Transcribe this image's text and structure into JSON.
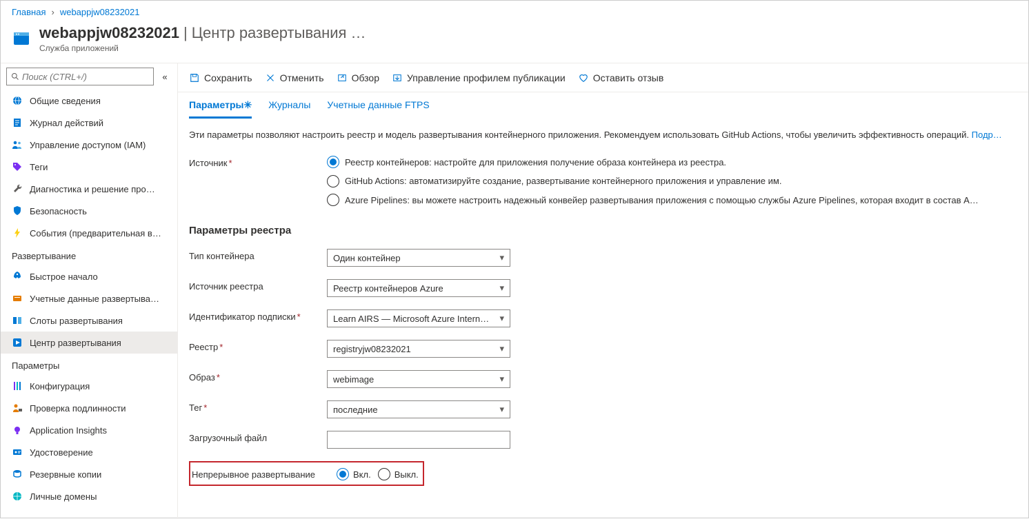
{
  "breadcrumb": {
    "home": "Главная",
    "resource": "webappjw08232021"
  },
  "header": {
    "title_main": "webappjw08232021",
    "title_sub": "Центр развертывания",
    "more": "…",
    "subtitle": "Служба приложений"
  },
  "search": {
    "placeholder": "Поиск (CTRL+/)",
    "collapse_glyph": "«"
  },
  "sidebar": {
    "section_general": [
      {
        "label": "Общие сведения"
      },
      {
        "label": "Журнал действий"
      },
      {
        "label": "Управление доступом (IAM)"
      },
      {
        "label": "Теги"
      },
      {
        "label": "Диагностика и решение про…"
      },
      {
        "label": "Безопасность"
      },
      {
        "label": "События (предварительная в…"
      }
    ],
    "section_deploy_title": "Развертывание",
    "section_deploy": [
      {
        "label": "Быстрое начало"
      },
      {
        "label": "Учетные данные развертыва…"
      },
      {
        "label": "Слоты развертывания"
      },
      {
        "label": "Центр развертывания",
        "active": true
      }
    ],
    "section_settings_title": "Параметры",
    "section_settings": [
      {
        "label": "Конфигурация"
      },
      {
        "label": "Проверка подлинности"
      },
      {
        "label": "Application Insights"
      },
      {
        "label": "Удостоверение"
      },
      {
        "label": "Резервные копии"
      },
      {
        "label": "Личные домены"
      }
    ]
  },
  "toolbar": {
    "save": "Сохранить",
    "discard": "Отменить",
    "browse": "Обзор",
    "manage_profile": "Управление профилем публикации",
    "feedback": "Оставить отзыв"
  },
  "tabs": {
    "settings": "Параметры",
    "settings_dirty": "✳",
    "logs": "Журналы",
    "ftps": "Учетные данные FTPS"
  },
  "intro": {
    "text": "Эти параметры позволяют настроить реестр и модель развертывания контейнерного приложения. Рекомендуем использовать GitHub Actions, чтобы увеличить эффективность операций.",
    "more": "Подр…"
  },
  "source": {
    "label": "Источник",
    "options": {
      "registry": "Реестр контейнеров: настройте для приложения получение образа контейнера из реестра.",
      "github": "GitHub Actions: автоматизируйте создание, развертывание контейнерного приложения и управление им.",
      "pipelines": "Azure Pipelines: вы можете настроить надежный конвейер развертывания приложения с помощью службы Azure Pipelines, которая входит в состав Azure DevOps Servic…"
    }
  },
  "registry": {
    "heading": "Параметры реестра",
    "container_type_label": "Тип контейнера",
    "container_type_value": "Один контейнер",
    "registry_source_label": "Источник реестра",
    "registry_source_value": "Реестр контейнеров Azure",
    "subscription_label": "Идентификатор подписки",
    "subscription_value": "Learn AIRS — Microsoft Azure Intern…",
    "registry_label": "Реестр",
    "registry_value": "registryjw08232021",
    "image_label": "Образ",
    "image_value": "webimage",
    "tag_label": "Тег",
    "tag_value": "последние",
    "startup_file_label": "Загрузочный файл",
    "startup_file_value": ""
  },
  "cd": {
    "label": "Непрерывное развертывание",
    "on": "Вкл.",
    "off": "Выкл."
  }
}
